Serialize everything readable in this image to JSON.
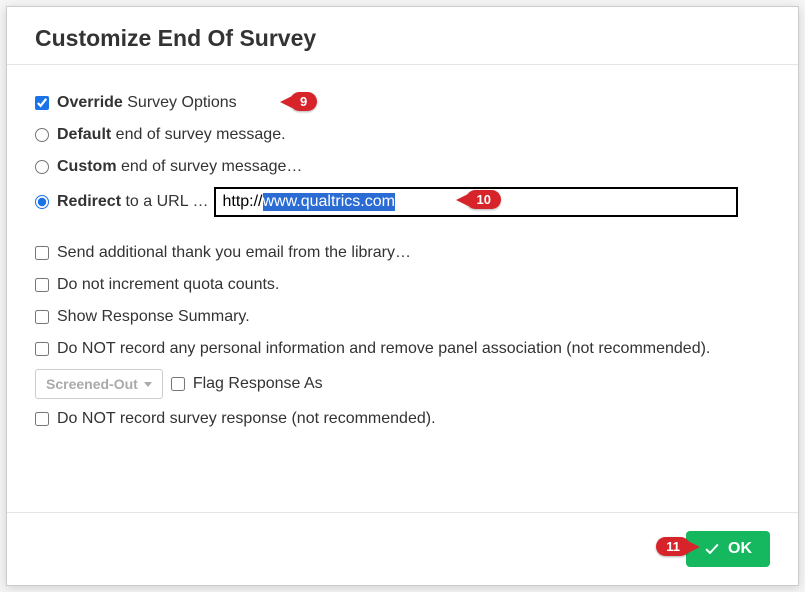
{
  "header": {
    "title": "Customize End Of Survey"
  },
  "options": {
    "override": {
      "label_b": "Override",
      "label_rest": " Survey Options"
    },
    "default": {
      "label_b": "Default",
      "label_rest": " end of survey message."
    },
    "custom": {
      "label_b": "Custom",
      "label_rest": " end of survey message…"
    },
    "redirect": {
      "label_b": "Redirect",
      "label_rest": " to a URL …"
    },
    "url_prefix": "http://",
    "url_selected": "www.qualtrics.com"
  },
  "advanced": {
    "thankyou": "Send additional thank you email from the library…",
    "quota": "Do not increment quota counts.",
    "summary": "Show Response Summary.",
    "noPII": "Do NOT record any personal information and remove panel association (not recommended).",
    "screened_label": "Screened-Out",
    "flag": "Flag Response As",
    "noRecord": "Do NOT record survey response (not recommended)."
  },
  "footer": {
    "ok": "OK"
  },
  "annotations": {
    "a9": "9",
    "a10": "10",
    "a11": "11"
  }
}
